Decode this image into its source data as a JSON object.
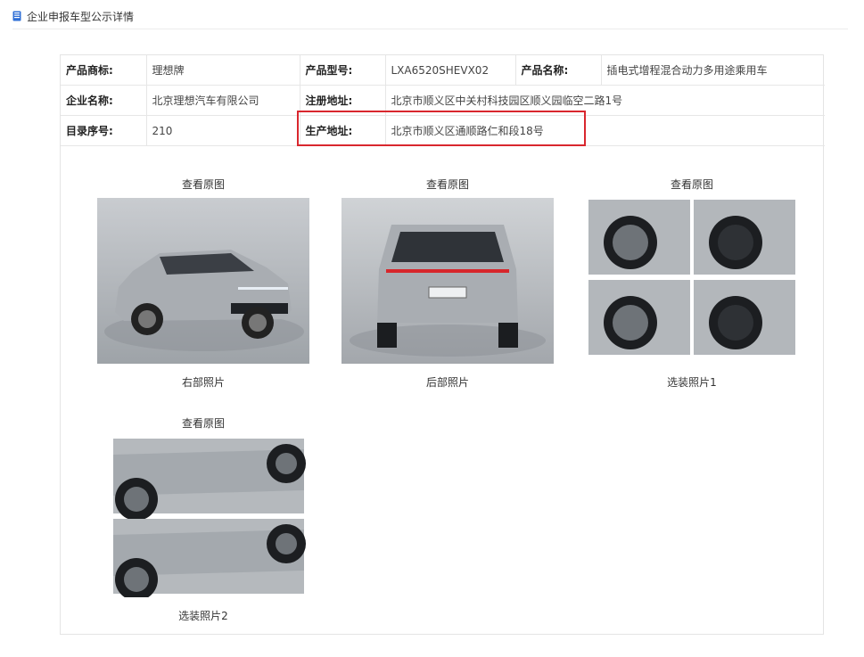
{
  "header": {
    "title": "企业申报车型公示详情"
  },
  "info_table": {
    "rows": [
      [
        {
          "label": "产品商标:",
          "value": "理想牌"
        },
        {
          "label": "产品型号:",
          "value": "LXA6520SHEVX02"
        },
        {
          "label": "产品名称:",
          "value": "插电式增程混合动力多用途乘用车"
        }
      ],
      [
        {
          "label": "企业名称:",
          "value": "北京理想汽车有限公司"
        },
        {
          "label": "注册地址:",
          "value": "北京市顺义区中关村科技园区顺义园临空二路1号"
        }
      ],
      [
        {
          "label": "目录序号:",
          "value": "210"
        },
        {
          "label": "生产地址:",
          "value": "北京市顺义区通顺路仁和段18号"
        }
      ]
    ]
  },
  "photos": [
    {
      "link": "查看原图",
      "caption": "右部照片"
    },
    {
      "link": "查看原图",
      "caption": "后部照片"
    },
    {
      "link": "查看原图",
      "caption": "选装照片1"
    },
    {
      "link": "查看原图",
      "caption": "选装照片2"
    }
  ],
  "colors": {
    "highlight": "#d9272e",
    "header_icon": "#2f6fd6",
    "car_body": "#a9adb2"
  }
}
